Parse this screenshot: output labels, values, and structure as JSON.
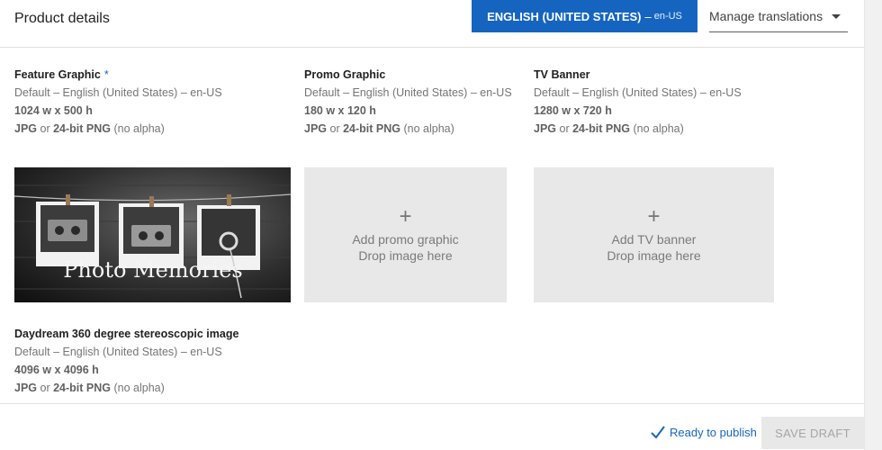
{
  "header": {
    "title": "Product details",
    "language_button": {
      "label": "ENGLISH (UNITED STATES)",
      "separator": "–",
      "code": "en-US"
    },
    "manage_translations": "Manage translations"
  },
  "assets": [
    {
      "title": "Feature Graphic",
      "required_marker": "*",
      "language": "Default – English (United States) – en-US",
      "dimensions": "1024 w x 500 h",
      "format_a": "JPG",
      "format_or": "or",
      "format_b": "24-bit PNG",
      "format_note": "(no alpha)",
      "image_text": "Photo Memories"
    },
    {
      "title": "Promo Graphic",
      "language": "Default – English (United States) – en-US",
      "dimensions": "180 w x 120 h",
      "format_a": "JPG",
      "format_or": "or",
      "format_b": "24-bit PNG",
      "format_note": "(no alpha)",
      "drop_plus": "+",
      "drop_line1": "Add promo graphic",
      "drop_line2": "Drop image here"
    },
    {
      "title": "TV Banner",
      "language": "Default – English (United States) – en-US",
      "dimensions": "1280 w x 720 h",
      "format_a": "JPG",
      "format_or": "or",
      "format_b": "24-bit PNG",
      "format_note": "(no alpha)",
      "drop_plus": "+",
      "drop_line1": "Add TV banner",
      "drop_line2": "Drop image here"
    },
    {
      "title": "Daydream 360 degree stereoscopic image",
      "language": "Default – English (United States) – en-US",
      "dimensions": "4096 w x 4096 h",
      "format_a": "JPG",
      "format_or": "or",
      "format_b": "24-bit PNG",
      "format_note": "(no alpha)"
    }
  ],
  "footer": {
    "status": "Ready to publish",
    "save_draft": "SAVE DRAFT"
  },
  "colors": {
    "accent": "#1565c0",
    "dropzone_bg": "#e8e8e8",
    "disabled_text": "#a5a5a5"
  }
}
